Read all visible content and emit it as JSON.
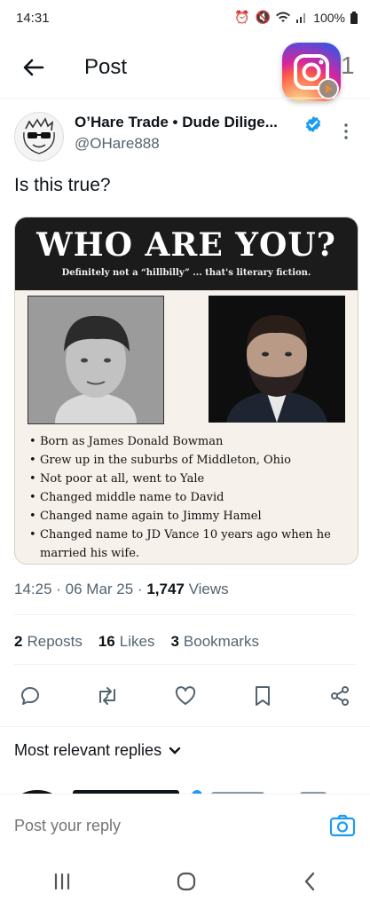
{
  "status_bar": {
    "time": "14:31",
    "battery": "100%",
    "icons": [
      "alarm-icon",
      "mute-icon",
      "wifi-icon",
      "signal-icon",
      "signal-icon",
      "battery-icon"
    ]
  },
  "header": {
    "title": "Post",
    "back_icon": "arrow-left-icon"
  },
  "overlay": {
    "app_icon": "instagram-icon",
    "partial_digit": "1"
  },
  "tweet": {
    "author_name": "O’Hare Trade • Dude Dilige...",
    "handle": "@OHare888",
    "text": "Is this true?",
    "media": {
      "title": "WHO ARE YOU?",
      "subtitle": "Definitely not a “hillbilly” ... that's literary fiction.",
      "bullets": [
        "Born as James Donald Bowman",
        "Grew up in the suburbs of Middleton, Ohio",
        "Not poor at all, went to Yale",
        "Changed middle name to David",
        "Changed name again to Jimmy Hamel",
        "Changed name to JD Vance 10 years ago when he married his wife."
      ]
    },
    "meta": {
      "time": "14:25",
      "date": "06 Mar 25",
      "views_count": "1,747",
      "views_label": "Views"
    },
    "stats": {
      "reposts_count": "2",
      "reposts_label": "Reposts",
      "likes_count": "16",
      "likes_label": "Likes",
      "bookmarks_count": "3",
      "bookmarks_label": "Bookmarks"
    }
  },
  "replies": {
    "label": "Most relevant replies"
  },
  "reply_bar": {
    "placeholder": "Post your reply"
  },
  "colors": {
    "accent": "#1d9bf0",
    "text": "#0f1419",
    "muted": "#536471"
  }
}
